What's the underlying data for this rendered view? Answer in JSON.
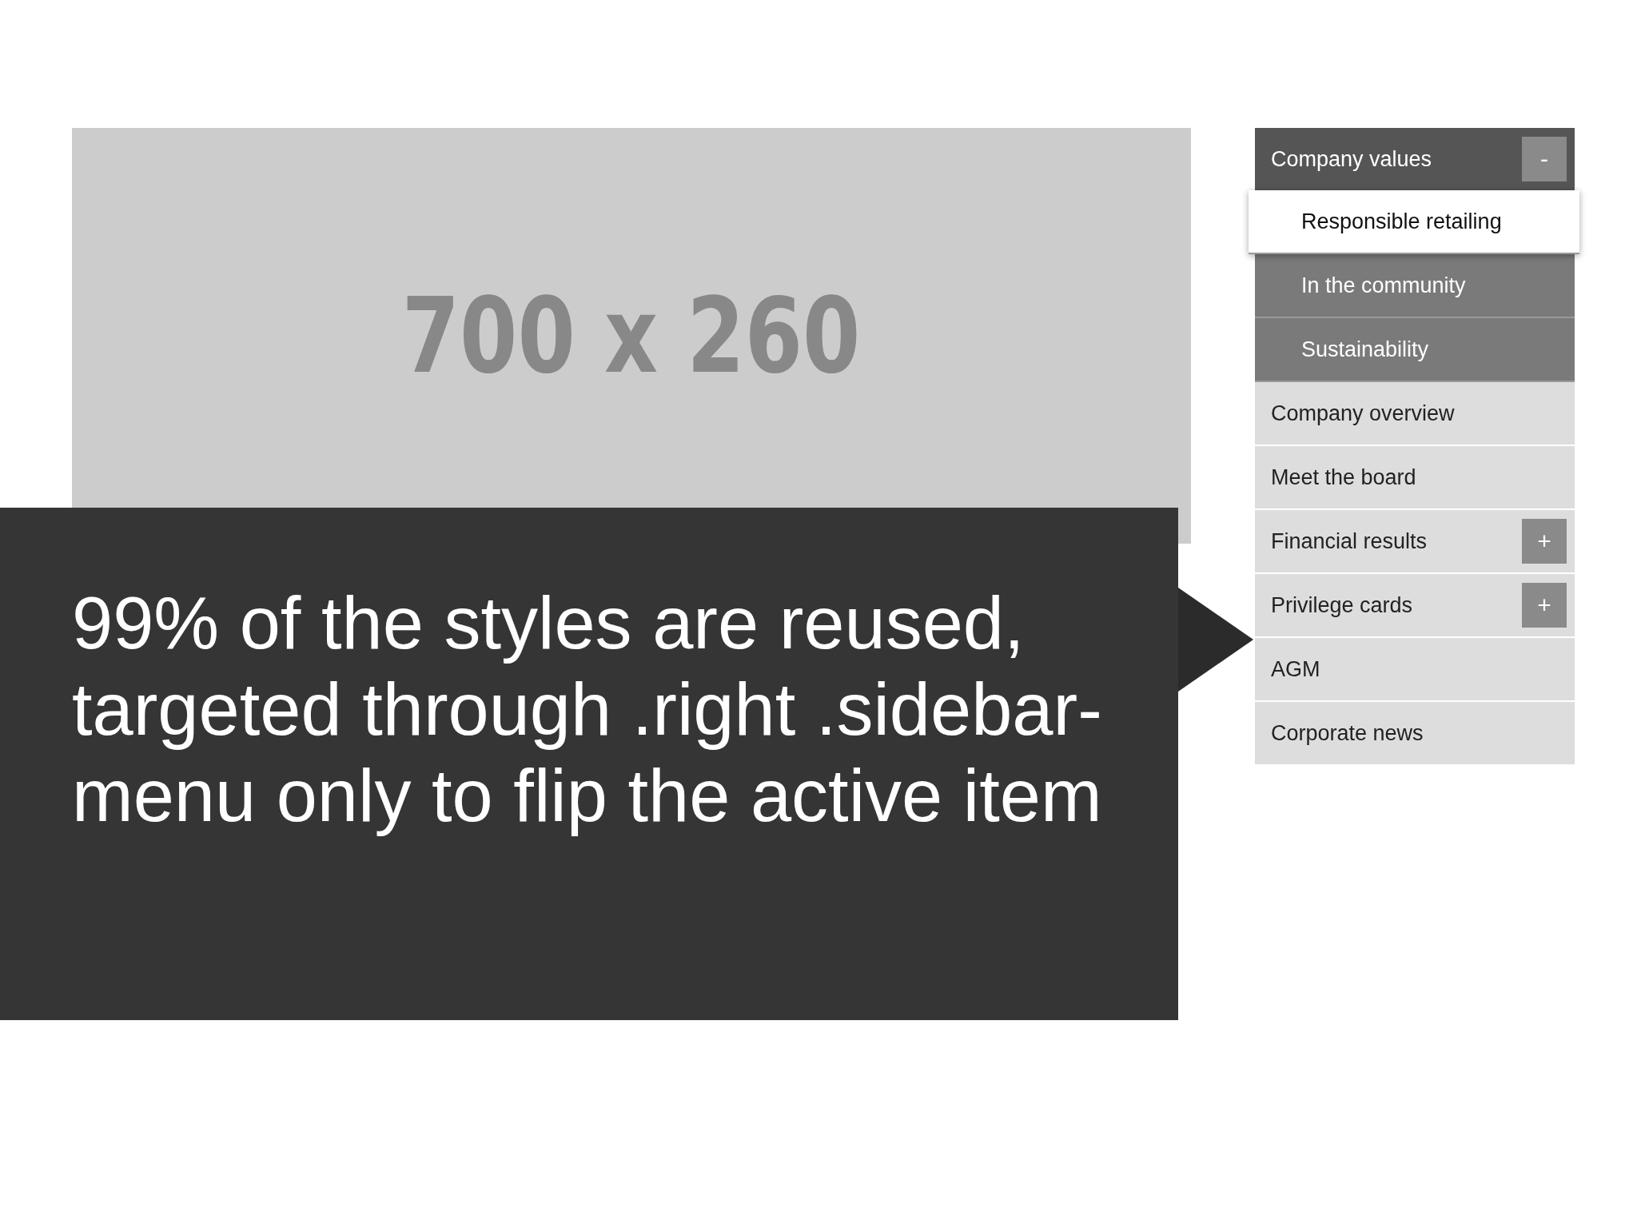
{
  "placeholders": {
    "main": "700 x 260"
  },
  "caption": "99% of the styles are reused, targeted through .right .sidebar-menu only to flip the active item",
  "sidebar": {
    "header": {
      "label": "Company values",
      "toggle": "-",
      "expanded": true
    },
    "children": [
      {
        "label": "Responsible retailing",
        "selected": true
      },
      {
        "label": "In the community",
        "selected": false
      },
      {
        "label": "Sustainability",
        "selected": false
      }
    ],
    "items": [
      {
        "label": "Company overview"
      },
      {
        "label": "Meet the board"
      },
      {
        "label": "Financial results",
        "toggle": "+"
      },
      {
        "label": "Privilege cards",
        "toggle": "+"
      },
      {
        "label": "AGM"
      },
      {
        "label": "Corporate news"
      }
    ]
  }
}
